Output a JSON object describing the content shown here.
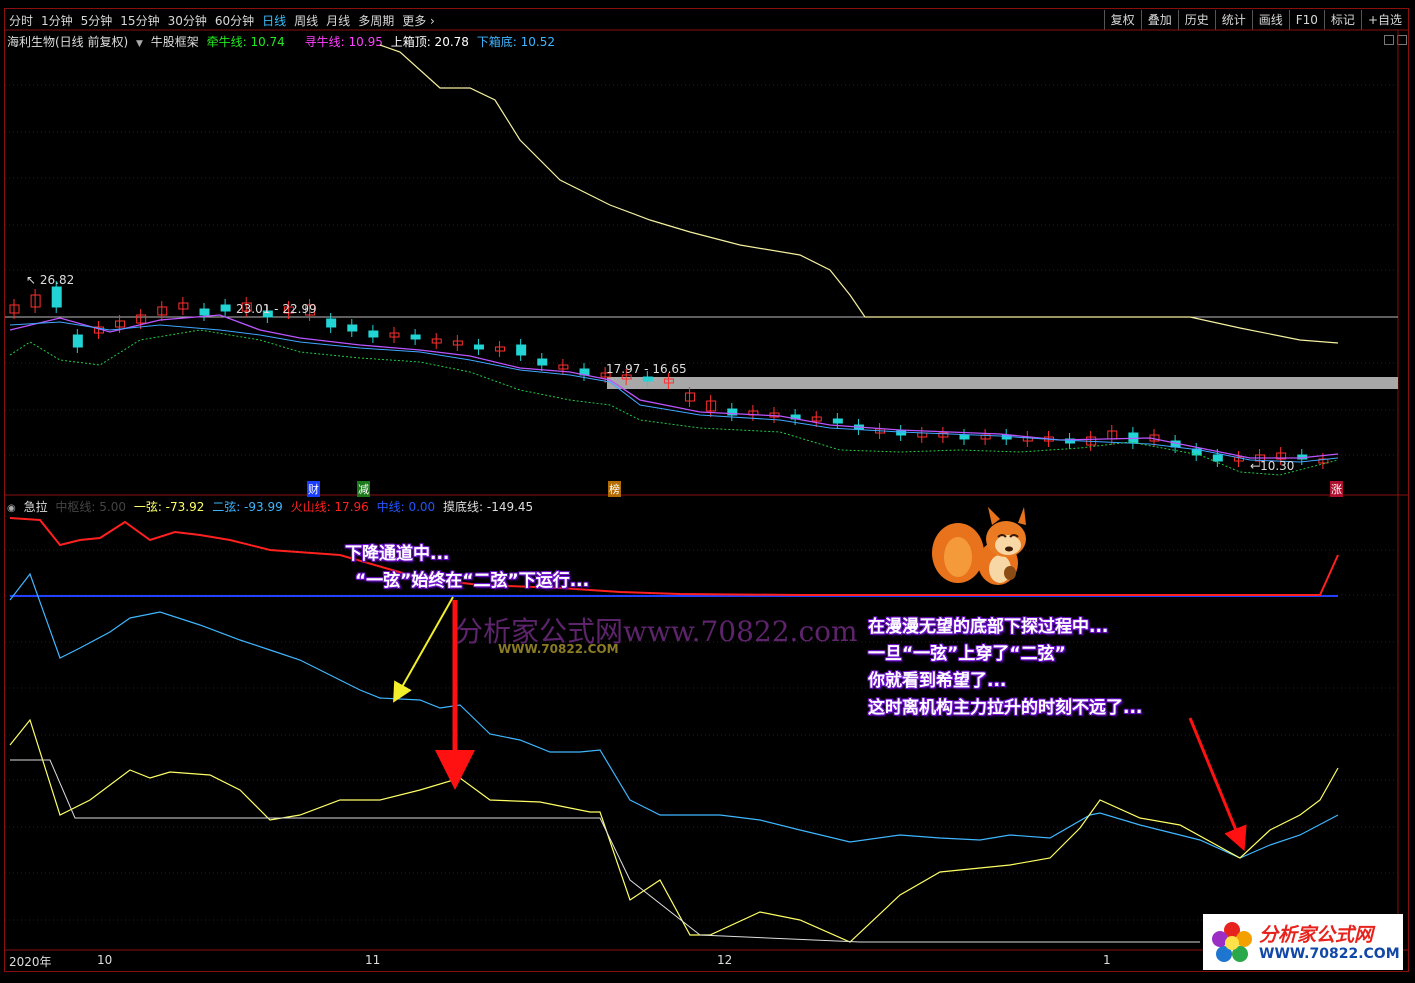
{
  "toolbar": {
    "periods": [
      "分时",
      "1分钟",
      "5分钟",
      "15分钟",
      "30分钟",
      "60分钟",
      "日线",
      "周线",
      "月线",
      "多周期",
      "更多 ›"
    ],
    "active_period": "日线",
    "right_buttons": [
      "复权",
      "叠加",
      "历史",
      "统计",
      "画线",
      "F10",
      "标记",
      "+自选"
    ]
  },
  "main_info": {
    "stock": "海利生物(日线 前复权)",
    "indicator": "牛股框架",
    "qianniu_label": "牵牛线: 10.74",
    "xunniu_label": "寻牛线: 10.95",
    "upper_label": "上箱顶: 20.78",
    "lower_label": "下箱底: 10.52",
    "colors": {
      "qianniu": "#22e822",
      "xunniu": "#ff40ff",
      "upper": "#ffffff",
      "lower": "#3fb6ff"
    }
  },
  "price_marks": {
    "high": "26.82",
    "range1": "23.01 - 22.99",
    "range2": "17.97 - 16.65",
    "low": "10.30"
  },
  "event_tags": [
    "财",
    "减",
    "榜",
    "涨"
  ],
  "sub_info": {
    "name": "急拉",
    "zhongxian": "中枢线: 5.00",
    "yixian": "一弦: -73.92",
    "erxian": "二弦: -93.99",
    "huoshan": "火山线: 17.96",
    "zhongxian2": "中线: 0.00",
    "modi": "摸底线: -149.45",
    "colors": {
      "yixian": "#ffff66",
      "erxian": "#3fb6ff",
      "huoshan": "#ff2020",
      "zhongxian2": "#2255ff"
    }
  },
  "annotations": {
    "left_line1": "下降通道中...",
    "left_line2": "“一弦”始终在“二弦”下运行...",
    "right_line1": "在漫漫无望的底部下探过程中...",
    "right_line2": "一旦“一弦”上穿了“二弦”",
    "right_line3": "你就看到希望了...",
    "right_line4": "这时离机构主力拉升的时刻不远了..."
  },
  "date_axis": [
    "2020年",
    "10",
    "11",
    "12",
    "1"
  ],
  "watermark": {
    "text": "分析家公式网www.70822.com",
    "sub": "WWW.70822.COM"
  },
  "logo": {
    "title": "分析家公式网",
    "url": "WWW.70822.COM"
  }
}
